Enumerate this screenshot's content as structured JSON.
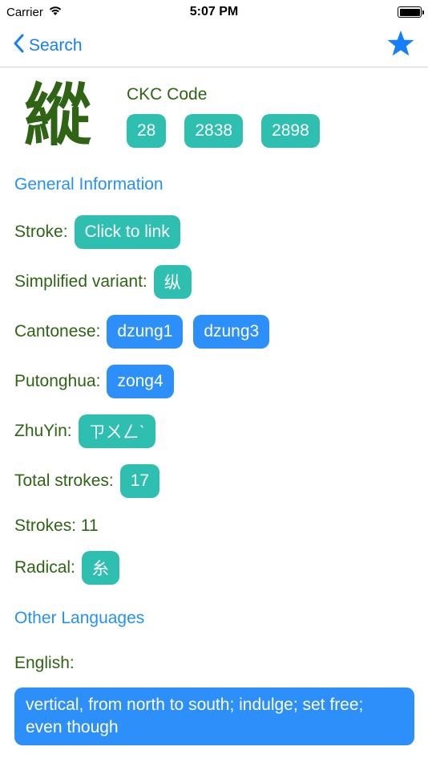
{
  "status": {
    "carrier": "Carrier",
    "time": "5:07 PM"
  },
  "nav": {
    "back_label": "Search",
    "back_icon": "chevron-left-icon",
    "favorite_icon": "star-icon"
  },
  "character": {
    "glyph": "縱",
    "ckc_title": "CKC Code",
    "ckc_codes": [
      "28",
      "2838",
      "2898"
    ]
  },
  "general": {
    "section_title": "General Information",
    "stroke_label": "Stroke:",
    "stroke_link": "Click to link",
    "simplified_label": "Simplified variant:",
    "simplified_value": "纵",
    "cantonese_label": "Cantonese:",
    "cantonese_values": [
      "dzung1",
      "dzung3"
    ],
    "putonghua_label": "Putonghua:",
    "putonghua_value": "zong4",
    "zhuyin_label": "ZhuYin:",
    "zhuyin_value": "ㄗㄨㄥˋ",
    "total_strokes_label": "Total strokes:",
    "total_strokes_value": "17",
    "strokes_text": "Strokes: 11",
    "radical_label": "Radical:",
    "radical_value": "糸"
  },
  "other": {
    "section_title": "Other Languages",
    "english_label": "English:",
    "english_value": "vertical, from north to south; indulge; set free; even though"
  },
  "colors": {
    "accent_blue": "#147efb",
    "chip_teal": "#2ebfb0",
    "chip_blue": "#2d8ffa",
    "label_green": "#2e6414"
  }
}
